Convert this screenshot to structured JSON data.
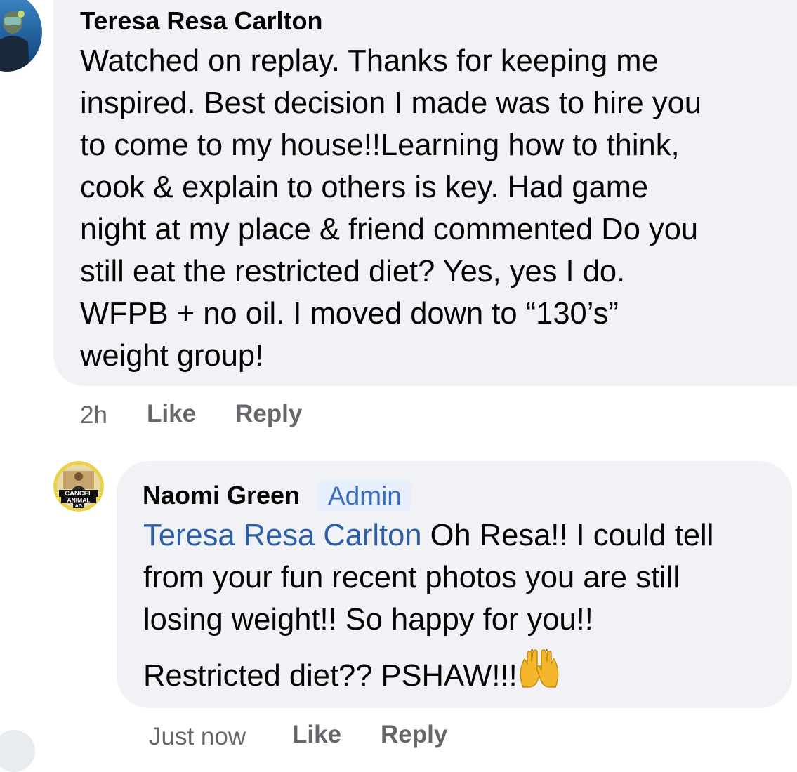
{
  "comments": [
    {
      "author": "Teresa Resa Carlton",
      "lines": [
        "Watched on replay.  Thanks for keeping me",
        "inspired.  Best decision I made was to hire you",
        "to come to my house!!Learning how to think,",
        "cook & explain to others is key.  Had game",
        "night at my place & friend commented Do you",
        "still eat the restricted diet?  Yes, yes I do.",
        "WFPB + no oil.  I moved down to “130’s”",
        "weight group!"
      ],
      "time": "2h",
      "like_label": "Like",
      "reply_label": "Reply"
    }
  ],
  "reply": {
    "author": "Naomi Green",
    "badge": "Admin",
    "avatar_text": [
      "CANCEL",
      "ANIMAL",
      "AG"
    ],
    "mention": "Teresa Resa Carlton",
    "lines": [
      " Oh Resa!! I could tell",
      "from your fun recent photos you are still",
      "losing weight!! So happy for you!!"
    ],
    "second_paragraph": "Restricted diet?? PSHAW!!!",
    "emoji": "raising-hands-emoji",
    "time": "Just now",
    "like_label": "Like",
    "reply_label": "Reply"
  }
}
